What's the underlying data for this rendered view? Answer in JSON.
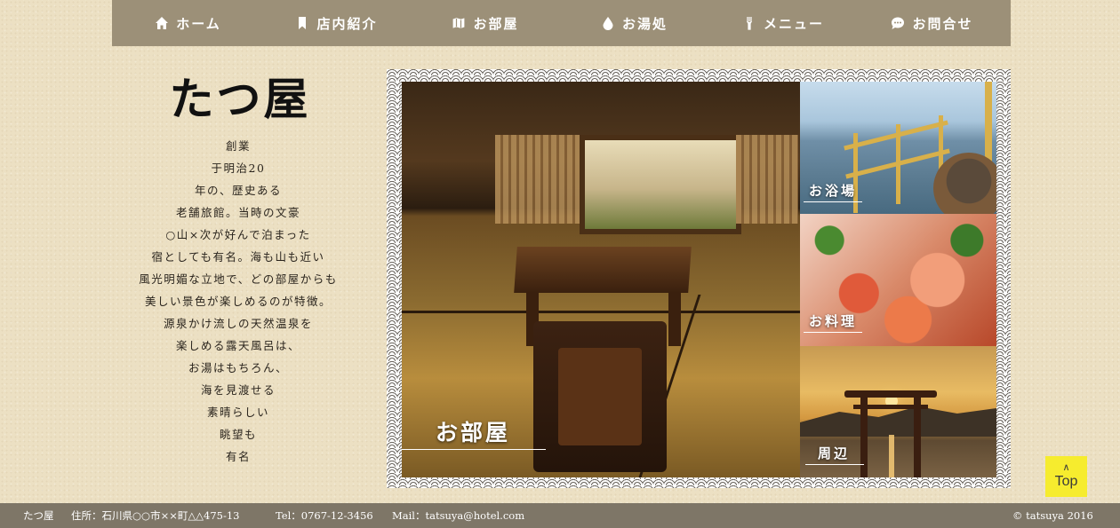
{
  "nav": {
    "items": [
      {
        "label": "ホーム",
        "icon": "home-icon"
      },
      {
        "label": "店内紹介",
        "icon": "bookmark-icon"
      },
      {
        "label": "お部屋",
        "icon": "map-icon"
      },
      {
        "label": "お湯処",
        "icon": "water-drop-icon"
      },
      {
        "label": "メニュー",
        "icon": "fork-icon"
      },
      {
        "label": "お問合せ",
        "icon": "chat-bubble-icon"
      }
    ]
  },
  "site": {
    "logo": "たつ屋",
    "intro_lines": [
      "創業",
      "于明治20",
      "年の、歴史ある",
      "老舗旅館。当時の文豪",
      "○山×次が好んで泊まった",
      "宿としても有名。海も山も近い",
      "風光明媚な立地で、どの部屋からも",
      "美しい景色が楽しめるのが特徴。",
      "源泉かけ流しの天然温泉を",
      "楽しめる露天風呂は、",
      "お湯はもちろん、",
      "海を見渡せる",
      "素晴らしい",
      "眺望も",
      "有名"
    ]
  },
  "gallery": {
    "main_caption": "お部屋",
    "side": [
      {
        "caption": "お浴場"
      },
      {
        "caption": "お料理"
      },
      {
        "caption": "周辺"
      }
    ]
  },
  "top_button": {
    "label": "Top",
    "icon": "chevron-up-icon"
  },
  "footer": {
    "name": "たつ屋",
    "address": "住所：石川県○○市××町△△475-13",
    "tel": "Tel：0767-12-3456",
    "mail": "Mail：tatsuya@hotel.com",
    "copyright": "© tatsuya 2016"
  }
}
